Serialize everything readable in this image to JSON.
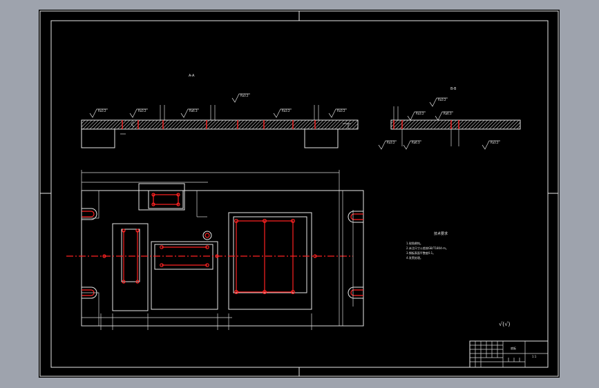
{
  "drawing": {
    "background_color": "#000000",
    "viewport_color": "#9ea3ad",
    "line_color": "#e9e9e9",
    "hole_color": "#ff2222",
    "roughness_marks": [
      "Ra3.2",
      "Ra6.3",
      "Ra1.6"
    ],
    "section_labels": {
      "section_a": "A-A",
      "section_b": "B-B"
    },
    "tech_requirements": {
      "heading": "技术要求",
      "items": [
        "1.锐角倒钝。",
        "2.未注尺寸公差按GB/T1804-m。",
        "3.钢板表面平整度0.1。",
        "4.发黑处理。"
      ]
    },
    "general_roughness": "√(√)",
    "title_block": {
      "part_name": "底板",
      "scale": "1:1"
    }
  }
}
